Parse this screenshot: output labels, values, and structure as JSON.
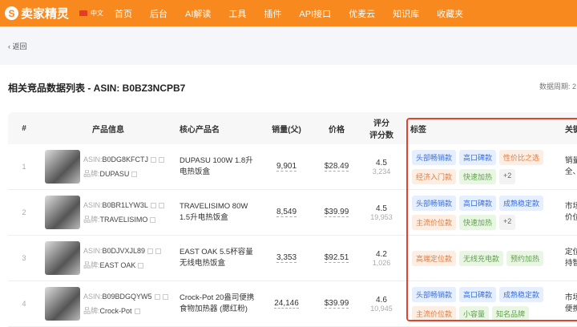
{
  "header": {
    "logo_text": "卖家精灵",
    "logo_glyph": "S",
    "lang": "中文",
    "nav": [
      "首页",
      "后台",
      "AI解读",
      "工具",
      "插件",
      "API接口",
      "优麦云",
      "知识库",
      "收藏夹"
    ]
  },
  "back_label": "返回",
  "page_title": "相关竞品数据列表 - ASIN: B0BZ3NCPB7",
  "period_label": "数据周期: 2",
  "table": {
    "headers": {
      "num": "#",
      "info": "产品信息",
      "core": "核心产品名",
      "sales": "销量(父)",
      "price": "价格",
      "rating": "评分",
      "rating_count": "评分数",
      "tags": "标签",
      "key": "关键"
    },
    "rows": [
      {
        "num": "1",
        "asin_label": "ASIN:",
        "asin": "B0DG8KFCTJ",
        "brand_label": "品牌:",
        "brand": "DUPASU",
        "core": "DUPASU 100W 1.8升电热饭盒",
        "sales": "9,901",
        "price": "$28.49",
        "rating": "4.5",
        "count": "3,234",
        "tags": [
          {
            "t": "头部畅销款",
            "c": "blue"
          },
          {
            "t": "高口碑款",
            "c": "blue"
          },
          {
            "t": "性价比之选",
            "c": "orange"
          },
          {
            "t": "经济入门款",
            "c": "orange"
          },
          {
            "t": "快速加热",
            "c": "green"
          },
          {
            "t": "+2",
            "c": "gray"
          }
        ],
        "key": [
          "销量",
          "全、"
        ]
      },
      {
        "num": "2",
        "asin_label": "ASIN:",
        "asin": "B0BR1LYW3L",
        "brand_label": "品牌:",
        "brand": "TRAVELISIMO",
        "core": "TRAVELISIMO 80W 1.5升电热饭盒",
        "sales": "8,549",
        "price": "$39.99",
        "rating": "4.5",
        "count": "19,953",
        "tags": [
          {
            "t": "头部畅销款",
            "c": "blue"
          },
          {
            "t": "高口碑款",
            "c": "blue"
          },
          {
            "t": "成熟稳定款",
            "c": "blue"
          },
          {
            "t": "主流价位款",
            "c": "orange"
          },
          {
            "t": "快速加热",
            "c": "green"
          },
          {
            "t": "+2",
            "c": "gray"
          }
        ],
        "key": [
          "市场",
          "价位"
        ]
      },
      {
        "num": "3",
        "asin_label": "ASIN:",
        "asin": "B0DJVXJL89",
        "brand_label": "品牌:",
        "brand": "EAST OAK",
        "core": "EAST OAK 5.5杯容量无线电热饭盒",
        "sales": "3,353",
        "price": "$92.51",
        "rating": "4.2",
        "count": "1,026",
        "tags": [
          {
            "t": "高端定位款",
            "c": "orange"
          },
          {
            "t": "无线充电款",
            "c": "green"
          },
          {
            "t": "预约加热",
            "c": "green"
          }
        ],
        "key": [
          "定位",
          "持智"
        ]
      },
      {
        "num": "4",
        "asin_label": "ASIN:",
        "asin": "B09BDGQYW5",
        "brand_label": "品牌:",
        "brand": "Crock-Pot",
        "core": "Crock-Pot 20盎司便携食物加热器 (腮红粉)",
        "sales": "24,146",
        "price": "$39.99",
        "rating": "4.6",
        "count": "10,945",
        "tags": [
          {
            "t": "头部畅销款",
            "c": "blue"
          },
          {
            "t": "高口碑款",
            "c": "blue"
          },
          {
            "t": "成熟稳定款",
            "c": "blue"
          },
          {
            "t": "主流价位款",
            "c": "orange"
          },
          {
            "t": "小容量",
            "c": "green"
          },
          {
            "t": "知名品牌",
            "c": "green"
          }
        ],
        "key": [
          "市场",
          "便携"
        ]
      }
    ]
  }
}
